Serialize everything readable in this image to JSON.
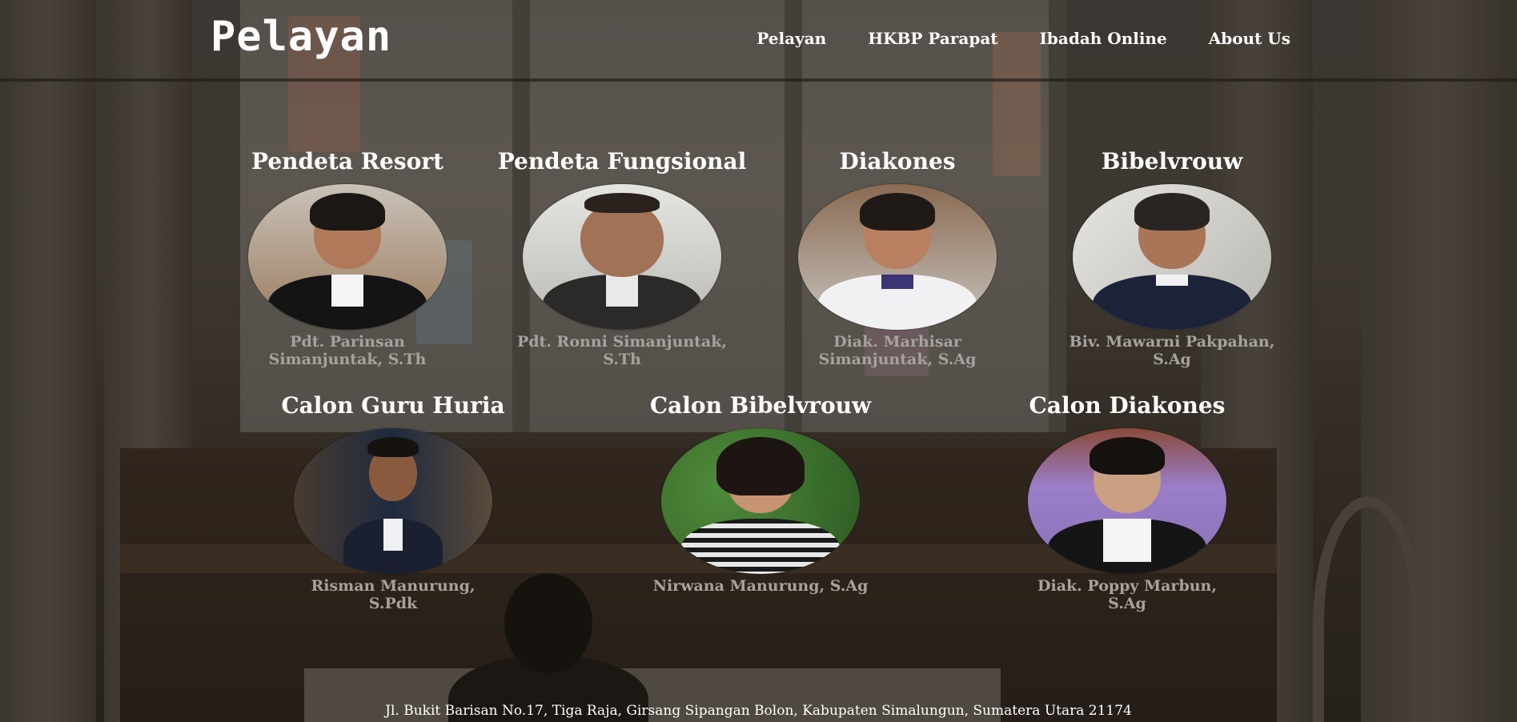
{
  "header": {
    "brand": "Pelayan",
    "nav": [
      "Pelayan",
      "HKBP Parapat",
      "Ibadah Online",
      "About Us"
    ]
  },
  "staff_row1": [
    {
      "role": "Pendeta Resort",
      "name": "Pdt. Parinsan Simanjuntak, S.Th"
    },
    {
      "role": "Pendeta Fungsional",
      "name": "Pdt. Ronni Simanjuntak, S.Th"
    },
    {
      "role": "Diakones",
      "name": "Diak. Marhisar Simanjuntak, S.Ag"
    },
    {
      "role": "Bibelvrouw",
      "name": "Biv. Mawarni Pakpahan, S.Ag"
    }
  ],
  "staff_row2": [
    {
      "role": "Calon Guru Huria",
      "name": "Risman Manurung, S.Pdk"
    },
    {
      "role": "Calon Bibelvrouw",
      "name": "Nirwana Manurung, S.Ag"
    },
    {
      "role": "Calon Diakones",
      "name": "Diak. Poppy Marbun, S.Ag"
    }
  ],
  "footer": {
    "address": "Jl. Bukit Barisan No.17, Tiga Raja, Girsang Sipangan Bolon, Kabupaten Simalungun, Sumatera Utara 21174"
  }
}
